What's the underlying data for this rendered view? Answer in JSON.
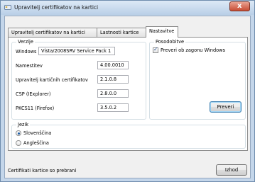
{
  "window": {
    "title": "Upravitelj certifikatov na kartici",
    "close_glyph": "x"
  },
  "tabs": [
    {
      "label": "Upravitelj certifikatov na kartici",
      "active": false
    },
    {
      "label": "Lastnosti kartice",
      "active": false
    },
    {
      "label": "Nastavitve",
      "active": true
    }
  ],
  "versions": {
    "title": "Verzije",
    "rows": [
      {
        "label": "Windows",
        "value": "Vista/2008SRV Service Pack 1"
      },
      {
        "label": "Namestitev",
        "value": "4.00.0010"
      },
      {
        "label": "Upravitelj kartičnih certifikatov",
        "value": "2.1.0.8"
      },
      {
        "label": "CSP (IExplorer)",
        "value": "2.8.0.0"
      },
      {
        "label": "PKCS11 (Firefox)",
        "value": "3.5.0.2"
      }
    ]
  },
  "updates": {
    "title": "Posodobitve",
    "checkbox_label": "Preveri ob zagonu Windows",
    "checkbox_checked": true,
    "check_button": "Preveri"
  },
  "language": {
    "title": "Jezik",
    "options": [
      {
        "label": "Slovenščina",
        "checked": true
      },
      {
        "label": "Angleščina",
        "checked": false
      }
    ]
  },
  "footer": {
    "status": "Certifikati kartice so prebrani",
    "exit_button": "Izhod"
  },
  "colors": {
    "accent": "#3c7fb1",
    "titlebar": "#c4d6ea"
  }
}
